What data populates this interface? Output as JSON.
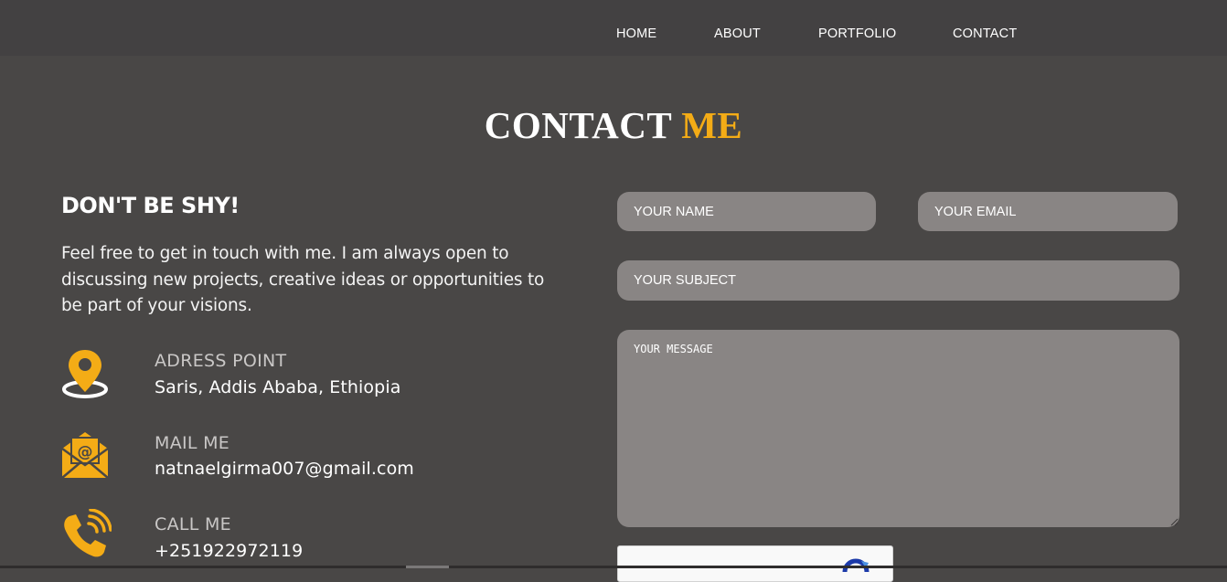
{
  "nav": {
    "items": [
      {
        "label": "HOME"
      },
      {
        "label": "ABOUT"
      },
      {
        "label": "PORTFOLIO"
      },
      {
        "label": "CONTACT"
      }
    ]
  },
  "title": {
    "main": "CONTACT",
    "accent": "ME"
  },
  "left": {
    "heading": "DON'T BE SHY!",
    "intro": "Feel free to get in touch with me. I am always open to discussing new projects, creative ideas or opportunities to be part of your visions.",
    "info": [
      {
        "icon": "location-pin-icon",
        "label": "ADRESS POINT",
        "value": "Saris, Addis Ababa, Ethiopia"
      },
      {
        "icon": "mail-envelope-icon",
        "label": "MAIL ME",
        "value": "natnaelgirma007@gmail.com"
      },
      {
        "icon": "phone-icon",
        "label": "CALL ME",
        "value": "+251922972119"
      }
    ]
  },
  "form": {
    "name_placeholder": "YOUR NAME",
    "email_placeholder": "YOUR EMAIL",
    "subject_placeholder": "YOUR SUBJECT",
    "message_placeholder": "YOUR MESSAGE"
  },
  "colors": {
    "background": "#494746",
    "navbar": "#434142",
    "accent": "#f4ac16",
    "field": "#898584"
  }
}
